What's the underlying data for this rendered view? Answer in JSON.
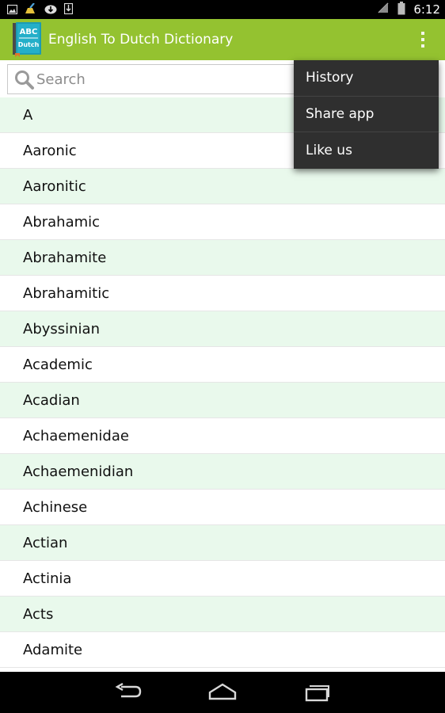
{
  "status_bar": {
    "time": "6:12",
    "left_icons": [
      "gallery-icon",
      "cleaner-icon",
      "download-cloud-icon",
      "download-icon"
    ],
    "right_icons": [
      "no-signal-icon",
      "battery-icon"
    ]
  },
  "action_bar": {
    "logo_top_text": "ABC",
    "logo_bottom_text": "Dutch",
    "title": "English To Dutch Dictionary",
    "overflow_icon": "overflow-menu-icon",
    "background": "#94c230"
  },
  "search": {
    "placeholder": "Search",
    "value": ""
  },
  "words": [
    "A",
    "Aaronic",
    "Aaronitic",
    "Abrahamic",
    "Abrahamite",
    "Abrahamitic",
    "Abyssinian",
    "Academic",
    "Acadian",
    "Achaemenidae",
    "Achaemenidian",
    "Achinese",
    "Actian",
    "Actinia",
    "Acts",
    "Adamite"
  ],
  "menu": {
    "items": [
      "History",
      "Share app",
      "Like us"
    ]
  },
  "nav_bar": {
    "icons": [
      "back-icon",
      "home-icon",
      "recent-apps-icon"
    ]
  },
  "colors": {
    "accent": "#94c230",
    "row_alt": "#e9f9ec",
    "menu_bg": "#2f2f2f"
  }
}
